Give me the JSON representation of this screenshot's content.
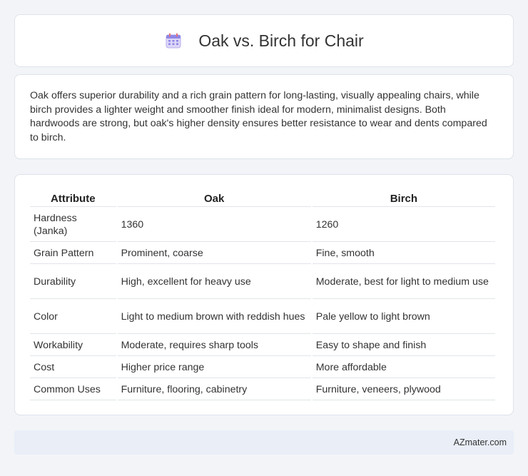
{
  "header": {
    "title": "Oak vs. Birch for Chair",
    "icon": "calendar-icon"
  },
  "summary": {
    "text": "Oak offers superior durability and a rich grain pattern for long-lasting, visually appealing chairs, while birch provides a lighter weight and smoother finish ideal for modern, minimalist designs. Both hardwoods are strong, but oak's higher density ensures better resistance to wear and dents compared to birch."
  },
  "table": {
    "headers": [
      "Attribute",
      "Oak",
      "Birch"
    ],
    "rows": [
      [
        "Hardness (Janka)",
        "1360",
        "1260"
      ],
      [
        "Grain Pattern",
        "Prominent, coarse",
        "Fine, smooth"
      ],
      [
        "Durability",
        "High, excellent for heavy use",
        "Moderate, best for light to medium use"
      ],
      [
        "Color",
        "Light to medium brown with reddish hues",
        "Pale yellow to light brown"
      ],
      [
        "Workability",
        "Moderate, requires sharp tools",
        "Easy to shape and finish"
      ],
      [
        "Cost",
        "Higher price range",
        "More affordable"
      ],
      [
        "Common Uses",
        "Furniture, flooring, cabinetry",
        "Furniture, veneers, plywood"
      ]
    ]
  },
  "footer": {
    "text": "AZmater.com"
  }
}
